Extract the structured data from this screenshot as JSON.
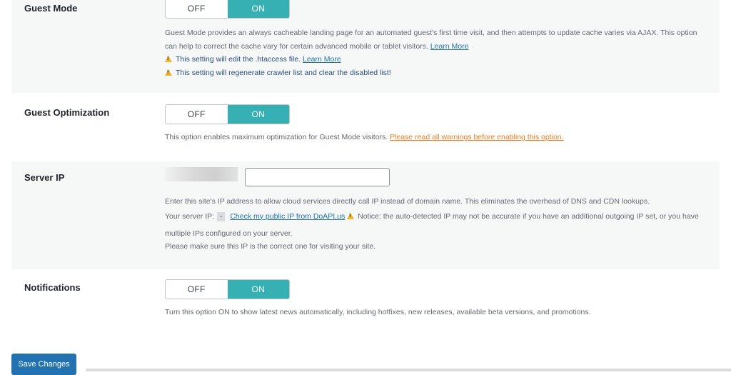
{
  "toggle_labels": {
    "off": "OFF",
    "on": "ON"
  },
  "guest_mode": {
    "label": "Guest Mode",
    "state": "ON",
    "desc_line1": "Guest Mode provides an always cacheable landing page for an automated guest's first time visit, and then attempts to update cache varies via AJAX. This option",
    "desc_line2": "can help to correct the cache vary for certain advanced mobile or tablet visitors.",
    "learn_more": "Learn More",
    "warning_htaccess": "This setting will edit the .htaccess file.",
    "warning_htaccess_link": "Learn More",
    "warning_crawler": "This setting will regenerate crawler list and clear the disabled list!"
  },
  "guest_optimization": {
    "label": "Guest Optimization",
    "state": "ON",
    "desc": "This option enables maximum optimization for Guest Mode visitors.",
    "warning_link": "Please read all warnings before enabling this option."
  },
  "server_ip": {
    "label": "Server IP",
    "input_value": "",
    "desc_line1": "Enter this site's IP address to allow cloud services directly call IP instead of domain name. This eliminates the overhead of DNS and CDN lookups.",
    "your_ip_label": "Your server IP:",
    "detected_ip": "-",
    "check_link": "Check my public IP from DoAPI.us",
    "notice": "Notice: the auto-detected IP may not be accurate if you have an additional outgoing IP set, or you have",
    "desc_line3": "multiple IPs configured on your server.",
    "desc_line4": "Please make sure this IP is the correct one for visiting your site."
  },
  "notifications": {
    "label": "Notifications",
    "state": "ON",
    "desc": "Turn this option ON to show latest news automatically, including hotfixes, new releases, available beta versions, and promotions."
  },
  "save_button": "Save Changes",
  "colors": {
    "toggle_on": "#36b0b2",
    "link": "#2271b1",
    "warning_link": "#e67e22",
    "button": "#2271b1",
    "row_shade": "#f6f7f7"
  },
  "icons": {
    "warning": "warning-icon"
  }
}
